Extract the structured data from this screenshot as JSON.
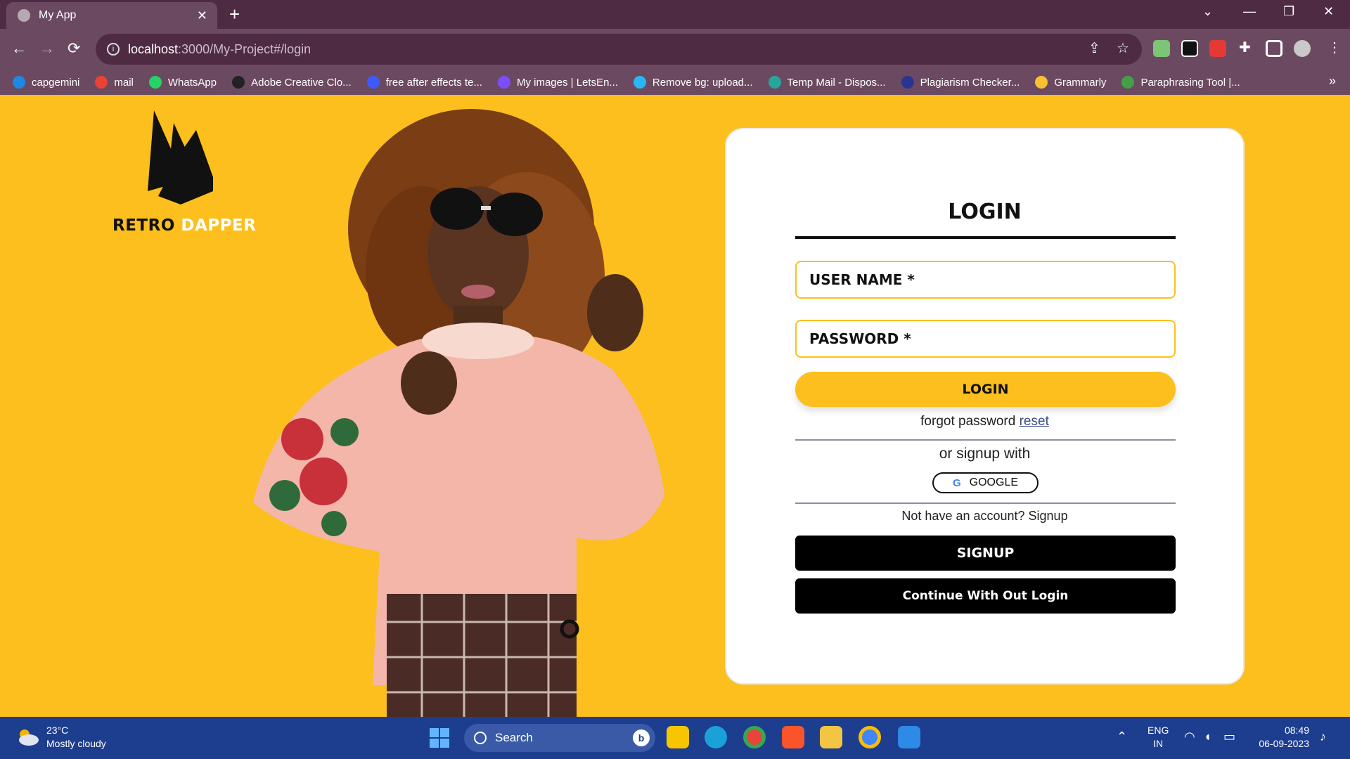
{
  "browser": {
    "tab_title": "My App",
    "tab_close": "✕",
    "new_tab": "+",
    "url_host": "localhost",
    "url_path": ":3000/My-Project#/login",
    "window_controls": {
      "dropdown": "⌄",
      "minimize": "—",
      "restore": "❐",
      "close": "✕"
    },
    "nav": {
      "back": "←",
      "forward": "→",
      "reload": "⟳"
    },
    "omni_actions": {
      "share": "⇪",
      "bookmark": "☆"
    },
    "menu": "⋮",
    "bookmarks": [
      {
        "label": "capgemini",
        "color": "#1e88e5"
      },
      {
        "label": "mail",
        "color": "#ea4335"
      },
      {
        "label": "WhatsApp",
        "color": "#25d366"
      },
      {
        "label": "Adobe Creative Clo...",
        "color": "#222222"
      },
      {
        "label": "free after effects te...",
        "color": "#3d5afe"
      },
      {
        "label": "My images | LetsEn...",
        "color": "#7c4dff"
      },
      {
        "label": "Remove bg: upload...",
        "color": "#29b6f6"
      },
      {
        "label": "Temp Mail - Dispos...",
        "color": "#26a69a"
      },
      {
        "label": "Plagiarism Checker...",
        "color": "#283593"
      },
      {
        "label": "Grammarly",
        "color": "#fbc02d"
      },
      {
        "label": "Paraphrasing Tool |...",
        "color": "#43a047"
      }
    ],
    "bookmarks_more": "»"
  },
  "page": {
    "logo": {
      "word1": "RETRO",
      "word2": "DAPPER"
    },
    "form": {
      "title": "LOGIN",
      "username_label": "USER NAME *",
      "password_label": "PASSWORD *",
      "login_button": "LOGIN",
      "forgot_text": "forgot password",
      "reset_link": "reset",
      "or_signup_text": "or signup with",
      "google_button": "GOOGLE",
      "no_account_text": "Not have an account? Signup",
      "signup_button": "SIGNUP",
      "continue_button": "Continue With Out Login"
    }
  },
  "taskbar": {
    "weather_temp": "23°C",
    "weather_desc": "Mostly cloudy",
    "search_label": "Search",
    "bing_label": "b",
    "lang_top": "ENG",
    "lang_bottom": "IN",
    "time": "08:49",
    "date": "06-09-2023"
  }
}
